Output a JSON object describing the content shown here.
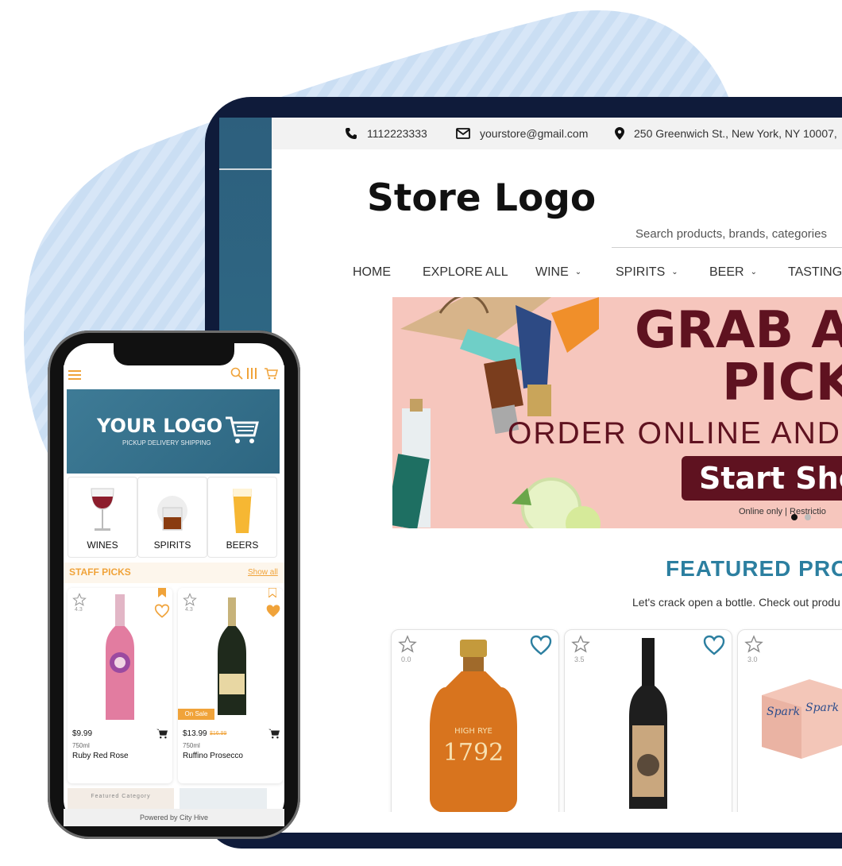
{
  "desktop": {
    "topbar": {
      "phone": "1112223333",
      "email": "yourstore@gmail.com",
      "address": "250 Greenwich St., New York, NY 10007,"
    },
    "store_logo": "Store Logo",
    "search_placeholder": "Search products, brands, categories",
    "nav": [
      "HOME",
      "EXPLORE ALL",
      "WINE",
      "SPIRITS",
      "BEER",
      "TASTINGS"
    ],
    "banner": {
      "headline1": "GRAB AN",
      "headline2": "PICK",
      "headline3": "ORDER ONLINE AND",
      "cta": "Start Shop",
      "disclaimer": "Online only | Restrictio"
    },
    "featured_title": "FEATURED PRO",
    "featured_sub": "Let's crack open a bottle. Check out produ",
    "products": [
      {
        "rating": "0.0"
      },
      {
        "rating": "3.5"
      },
      {
        "rating": "3.0"
      }
    ]
  },
  "mobile": {
    "logo_title": "YOUR LOGO",
    "logo_sub": "PICKUP  DELIVERY  SHIPPING",
    "categories": [
      "WINES",
      "SPIRITS",
      "BEERS"
    ],
    "staff_picks": "STAFF PICKS",
    "show_all": "Show all",
    "picks": [
      {
        "rating": "4.3",
        "price": "$9.99",
        "size": "750ml",
        "name": "Ruby Red Rose"
      },
      {
        "rating": "4.3",
        "price": "$13.99",
        "old_price": "$16.99",
        "badge": "On Sale",
        "size": "750ml",
        "name": "Ruffino Prosecco"
      }
    ],
    "featured_category": "Featured Category",
    "powered_by": "Powered by City Hive"
  },
  "colors": {
    "accent_teal": "#2c7fa0",
    "banner_red": "#5f1220",
    "banner_bg": "#f6c6bd",
    "mobile_accent": "#f0a33a",
    "frame_navy": "#0f1b3a"
  }
}
